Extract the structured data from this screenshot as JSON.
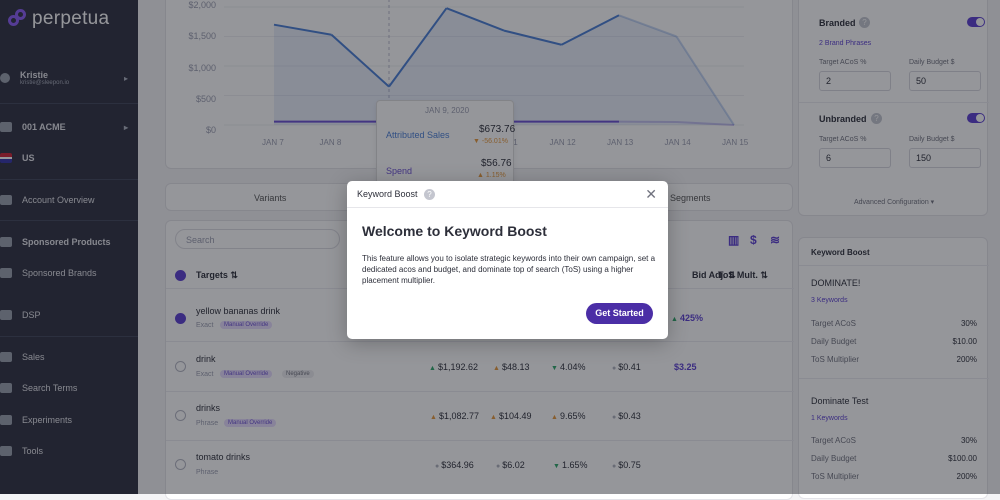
{
  "brand": {
    "name": "perpetua"
  },
  "sidebar": {
    "user": {
      "name": "Kristie",
      "email": "kristie@sleepon.io"
    },
    "account": "001 ACME",
    "region": "US",
    "items": [
      {
        "label": "Account Overview",
        "icon": "home-icon"
      },
      {
        "label": "Sponsored Products",
        "icon": "bag-icon",
        "active": true
      },
      {
        "label": "Sponsored Brands",
        "icon": "layers-icon"
      },
      {
        "label": "DSP",
        "icon": "monitor-icon"
      },
      {
        "label": "Sales",
        "icon": "chart-icon"
      },
      {
        "label": "Search Terms",
        "icon": "search-icon"
      },
      {
        "label": "Experiments",
        "icon": "flask-icon"
      },
      {
        "label": "Tools",
        "icon": "wrench-icon"
      }
    ]
  },
  "chart_data": {
    "type": "area",
    "categories": [
      "JAN 7",
      "JAN 8",
      "JAN 9",
      "JAN 10",
      "JAN 11",
      "JAN 12",
      "JAN 13",
      "JAN 14",
      "JAN 15"
    ],
    "series": [
      {
        "name": "Attributed Sales",
        "values": [
          1700,
          1530,
          650,
          1980,
          1600,
          1360,
          1860,
          1500,
          0
        ]
      },
      {
        "name": "Spend",
        "values": [
          57,
          57,
          57,
          57,
          57,
          57,
          57,
          50,
          0
        ]
      }
    ],
    "yticks": [
      "$2,000",
      "$1,500",
      "$1,000",
      "$500",
      "$0"
    ],
    "ylim": [
      0,
      2000
    ],
    "colors": {
      "sales": "#4a7fd6",
      "spend": "#6b4fd4"
    }
  },
  "tooltip": {
    "date": "JAN 9, 2020",
    "rows": [
      {
        "label": "Attributed Sales",
        "value": "$673.76",
        "change": "-56.01%"
      },
      {
        "label": "Spend",
        "value": "$56.76",
        "change": "1.15%"
      }
    ]
  },
  "tabs": [
    "Variants",
    "Segments"
  ],
  "table": {
    "search_placeholder": "Search",
    "headers": {
      "targets": "Targets",
      "bid_adj": "Bid Adj.",
      "tos_mult": "ToS Mult."
    },
    "rows": [
      {
        "keyword": "yellow bananas drink",
        "match": "Exact",
        "tags": [
          "Manual Override"
        ],
        "checked": true,
        "cells": [
          "",
          "",
          "",
          "",
          "425%"
        ]
      },
      {
        "keyword": "drink",
        "match": "Exact",
        "tags": [
          "Manual Override",
          "Negative"
        ],
        "checked": false,
        "cells": [
          "$1,192.62",
          "$48.13",
          "4.04%",
          "$0.41",
          "$3.25"
        ]
      },
      {
        "keyword": "drinks",
        "match": "Phrase",
        "tags": [
          "Manual Override"
        ],
        "checked": false,
        "cells": [
          "$1,082.77",
          "$104.49",
          "9.65%",
          "$0.43",
          ""
        ]
      },
      {
        "keyword": "tomato drinks",
        "match": "Phrase",
        "tags": [],
        "checked": false,
        "cells": [
          "$364.96",
          "$6.02",
          "1.65%",
          "$0.75",
          ""
        ]
      }
    ]
  },
  "settings": {
    "branded": {
      "title": "Branded",
      "link": "2 Brand Phrases",
      "acos_label": "Target ACoS %",
      "acos": "2",
      "budget_label": "Daily Budget $",
      "budget": "50"
    },
    "unbranded": {
      "title": "Unbranded",
      "acos_label": "Target ACoS %",
      "acos": "6",
      "budget_label": "Daily Budget $",
      "budget": "150"
    },
    "advanced": "Advanced Configuration"
  },
  "keyword_boost": {
    "title": "Keyword Boost",
    "groups": [
      {
        "name": "DOMINATE!",
        "link": "3 Keywords",
        "acos_label": "Target ACoS",
        "acos": "30%",
        "budget_label": "Daily Budget",
        "budget": "$10.00",
        "mult_label": "ToS Multiplier",
        "mult": "200%"
      },
      {
        "name": "Dominate Test",
        "link": "1 Keywords",
        "acos_label": "Target ACoS",
        "acos": "30%",
        "budget_label": "Daily Budget",
        "budget": "$100.00",
        "mult_label": "ToS Multiplier",
        "mult": "200%"
      }
    ]
  },
  "modal": {
    "header": "Keyword Boost",
    "title": "Welcome to Keyword Boost",
    "body": "This feature allows you to isolate strategic keywords into their own campaign, set a dedicated acos and budget, and dominate top of search (ToS) using a higher placement multiplier.",
    "button": "Get Started"
  }
}
